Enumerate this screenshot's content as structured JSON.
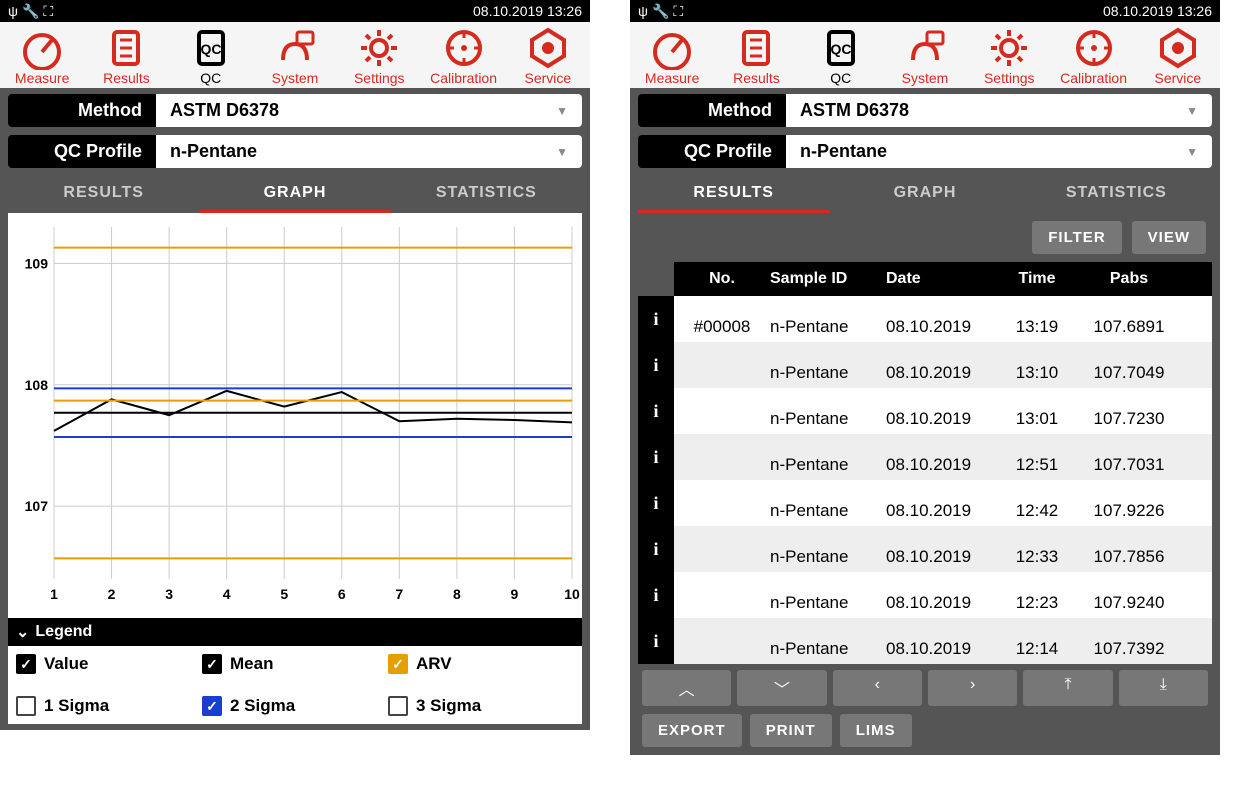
{
  "status": {
    "datetime": "08.10.2019 13:26"
  },
  "tabs": [
    {
      "id": "measure",
      "label": "Measure"
    },
    {
      "id": "results",
      "label": "Results"
    },
    {
      "id": "qc",
      "label": "QC"
    },
    {
      "id": "system",
      "label": "System"
    },
    {
      "id": "settings",
      "label": "Settings"
    },
    {
      "id": "calibration",
      "label": "Calibration"
    },
    {
      "id": "service",
      "label": "Service"
    }
  ],
  "selectors": {
    "method_label": "Method",
    "method_value": "ASTM D6378",
    "profile_label": "QC Profile",
    "profile_value": "n-Pentane"
  },
  "subtabs": {
    "results": "RESULTS",
    "graph": "GRAPH",
    "statistics": "STATISTICS"
  },
  "legend": {
    "title": "Legend",
    "items": [
      {
        "label": "Value",
        "checked": true,
        "color": "black"
      },
      {
        "label": "Mean",
        "checked": true,
        "color": "black"
      },
      {
        "label": "ARV",
        "checked": true,
        "color": "orange"
      },
      {
        "label": "1 Sigma",
        "checked": false,
        "color": ""
      },
      {
        "label": "2 Sigma",
        "checked": true,
        "color": "blue"
      },
      {
        "label": "3 Sigma",
        "checked": false,
        "color": ""
      }
    ]
  },
  "buttons": {
    "filter": "FILTER",
    "view": "VIEW",
    "export": "EXPORT",
    "print": "PRINT",
    "lims": "LIMS"
  },
  "table": {
    "headers": {
      "no": "No.",
      "sid": "Sample ID",
      "date": "Date",
      "time": "Time",
      "pabs": "Pabs"
    },
    "rows": [
      {
        "no": "#00008",
        "sid": "n-Pentane",
        "date": "08.10.2019",
        "time": "13:19",
        "pabs": "107.6891"
      },
      {
        "no": "",
        "sid": "n-Pentane",
        "date": "08.10.2019",
        "time": "13:10",
        "pabs": "107.7049"
      },
      {
        "no": "",
        "sid": "n-Pentane",
        "date": "08.10.2019",
        "time": "13:01",
        "pabs": "107.7230"
      },
      {
        "no": "",
        "sid": "n-Pentane",
        "date": "08.10.2019",
        "time": "12:51",
        "pabs": "107.7031"
      },
      {
        "no": "",
        "sid": "n-Pentane",
        "date": "08.10.2019",
        "time": "12:42",
        "pabs": "107.9226"
      },
      {
        "no": "",
        "sid": "n-Pentane",
        "date": "08.10.2019",
        "time": "12:33",
        "pabs": "107.7856"
      },
      {
        "no": "",
        "sid": "n-Pentane",
        "date": "08.10.2019",
        "time": "12:23",
        "pabs": "107.9240"
      },
      {
        "no": "",
        "sid": "n-Pentane",
        "date": "08.10.2019",
        "time": "12:14",
        "pabs": "107.7392"
      }
    ]
  },
  "chart_data": {
    "type": "line",
    "x": [
      1,
      2,
      3,
      4,
      5,
      6,
      7,
      8,
      9,
      10
    ],
    "series": [
      {
        "name": "Value",
        "values": [
          107.62,
          107.88,
          107.75,
          107.95,
          107.82,
          107.94,
          107.7,
          107.72,
          107.71,
          107.69
        ],
        "color": "#000"
      },
      {
        "name": "Mean",
        "values": [
          107.77,
          107.77,
          107.77,
          107.77,
          107.77,
          107.77,
          107.77,
          107.77,
          107.77,
          107.77
        ],
        "color": "#000"
      },
      {
        "name": "ARV hi",
        "values": [
          109.13,
          109.13,
          109.13,
          109.13,
          109.13,
          109.13,
          109.13,
          109.13,
          109.13,
          109.13
        ],
        "color": "#e59f00"
      },
      {
        "name": "ARV lo",
        "values": [
          106.57,
          106.57,
          106.57,
          106.57,
          106.57,
          106.57,
          106.57,
          106.57,
          106.57,
          106.57
        ],
        "color": "#e59f00"
      },
      {
        "name": "ARV warn hi",
        "values": [
          107.87,
          107.87,
          107.87,
          107.87,
          107.87,
          107.87,
          107.87,
          107.87,
          107.87,
          107.87
        ],
        "color": "#e59f00"
      },
      {
        "name": "2Sigma hi",
        "values": [
          107.97,
          107.97,
          107.97,
          107.97,
          107.97,
          107.97,
          107.97,
          107.97,
          107.97,
          107.97
        ],
        "color": "#1a3fd0"
      },
      {
        "name": "2Sigma lo",
        "values": [
          107.57,
          107.57,
          107.57,
          107.57,
          107.57,
          107.57,
          107.57,
          107.57,
          107.57,
          107.57
        ],
        "color": "#1a3fd0"
      }
    ],
    "ylim": [
      106.4,
      109.3
    ],
    "yticks": [
      107,
      108,
      109
    ],
    "xlabel": "",
    "ylabel": ""
  }
}
